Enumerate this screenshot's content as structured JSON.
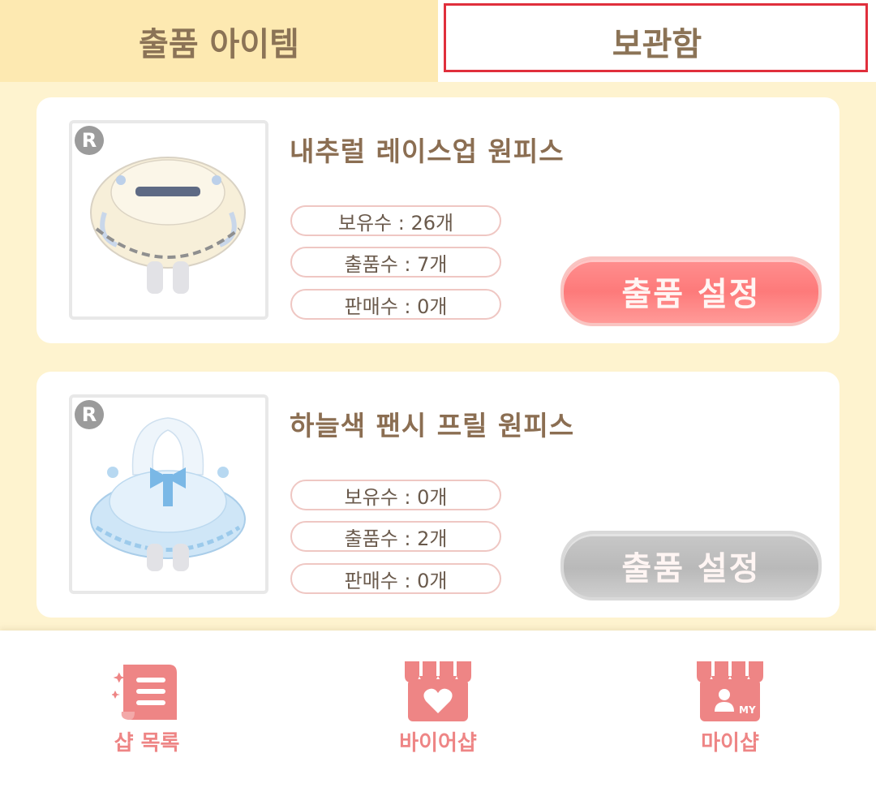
{
  "tabs": {
    "left_label": "출품 아이템",
    "right_label": "보관함"
  },
  "items": [
    {
      "rarity": "R",
      "name": "내추럴 레이스업 원피스",
      "owned": "보유수 : 26개",
      "listed": "출품수 : 7개",
      "sold": "판매수 : 0개",
      "button_label": "출품 설정",
      "button_state": "active"
    },
    {
      "rarity": "R",
      "name": "하늘색 팬시 프릴 원피스",
      "owned": "보유수 : 0개",
      "listed": "출품수 : 2개",
      "sold": "판매수 : 0개",
      "button_label": "출품 설정",
      "button_state": "disabled"
    }
  ],
  "bottom_nav": {
    "items": [
      {
        "label": "샵 목록",
        "icon": "scroll-list-icon"
      },
      {
        "label": "바이어샵",
        "icon": "shop-heart-icon"
      },
      {
        "label": "마이샵",
        "icon": "shop-my-icon"
      }
    ],
    "my_badge": "MY"
  },
  "colors": {
    "background": "#fef3cf",
    "tab_inactive": "#fde9b1",
    "selected_outline": "#e02f3c",
    "button_active": "#fd7a7a",
    "button_disabled": "#b9b9b9",
    "nav_accent": "#ee8585"
  }
}
